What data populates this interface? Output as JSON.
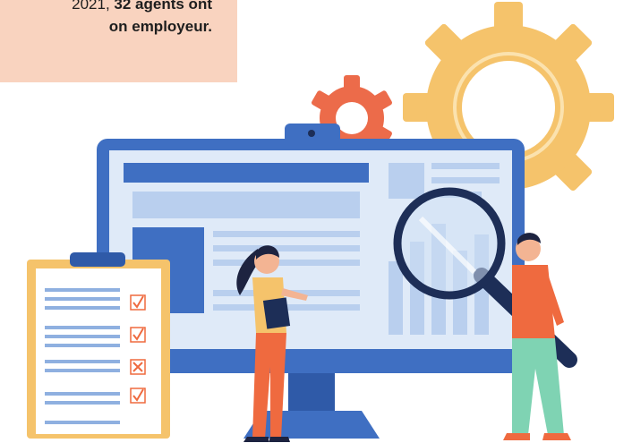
{
  "callout": {
    "line1_plain": "2021, ",
    "line1_bold": "32 agents ont",
    "line2_bold": "on employeur."
  },
  "illustration": {
    "icons": [
      "gear-icon",
      "monitor",
      "magnifying-glass-icon",
      "clipboard-checklist",
      "person-woman",
      "person-man"
    ],
    "colors": {
      "callout_bg": "#f9d3bf",
      "monitor_frame": "#3f6fc2",
      "gear_large": "#f5c36b",
      "gear_small": "#ec6b4a",
      "accent_orange": "#ef6a3f"
    },
    "checklist_marks": [
      "check",
      "check",
      "cross",
      "check"
    ]
  }
}
